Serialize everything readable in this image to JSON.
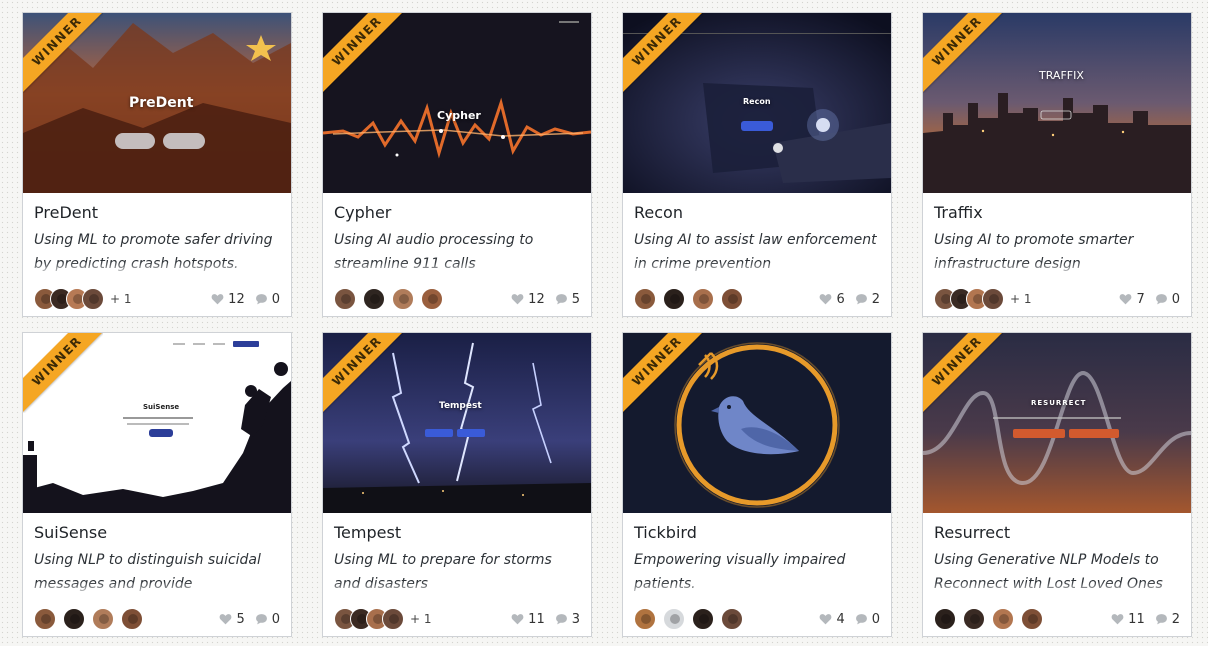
{
  "colors": {
    "ribbon": "#f5a623",
    "card_border": "#cfd2d6",
    "icon_gray": "#b4b8bc"
  },
  "cards": [
    {
      "name": "PreDent",
      "description": "Using ML to promote safer driving by predicting crash hotspots.",
      "badge": "WINNER",
      "thumb_title": "PreDent",
      "likes": "12",
      "comments": "0",
      "extra_members": "+ 1",
      "avatars": [
        "#8a5a3c",
        "#3b2a22",
        "#b77a55",
        "#6b4a3a"
      ]
    },
    {
      "name": "Cypher",
      "description": "Using AI audio processing to streamline 911 calls",
      "badge": "WINNER",
      "thumb_title": "Cypher",
      "likes": "12",
      "comments": "5",
      "extra_members": "",
      "avatars": [
        "#7a5540",
        "#2f2621",
        "#b07c5a",
        "#9a5f3e"
      ]
    },
    {
      "name": "Recon",
      "description": "Using AI to assist law enforcement in crime prevention",
      "badge": "WINNER",
      "thumb_title": "Recon",
      "likes": "6",
      "comments": "2",
      "extra_members": "",
      "avatars": [
        "#8a5a3c",
        "#2b211c",
        "#a86f4c",
        "#7e4f36"
      ]
    },
    {
      "name": "Traffix",
      "description": "Using AI to promote smarter infrastructure design",
      "badge": "WINNER",
      "thumb_title": "TRAFFIX",
      "likes": "7",
      "comments": "0",
      "extra_members": "+ 1",
      "avatars": [
        "#7a5540",
        "#3a2b24",
        "#b27650",
        "#6b4a3a"
      ]
    },
    {
      "name": "SuiSense",
      "description": "Using NLP to distinguish suicidal messages and provide personalized",
      "badge": "WINNER",
      "thumb_title": "SuiSense",
      "likes": "5",
      "comments": "0",
      "extra_members": "",
      "avatars": [
        "#8a5a3c",
        "#2b211c",
        "#b07c5a",
        "#7e4f36"
      ]
    },
    {
      "name": "Tempest",
      "description": "Using ML to prepare for storms and disasters",
      "badge": "WINNER",
      "thumb_title": "Tempest",
      "likes": "11",
      "comments": "3",
      "extra_members": "+ 1",
      "avatars": [
        "#7a5540",
        "#3b2a22",
        "#a86f4c",
        "#6b4a3a"
      ]
    },
    {
      "name": "Tickbird",
      "description": "Empowering visually impaired patients.",
      "badge": "WINNER",
      "thumb_title": "",
      "likes": "4",
      "comments": "0",
      "extra_members": "",
      "avatars": [
        "#b0733f",
        "#d6d9dc",
        "#2b211c",
        "#6b4a3a"
      ]
    },
    {
      "name": "Resurrect",
      "description": "Using Generative NLP Models to Reconnect with Lost Loved Ones",
      "badge": "WINNER",
      "thumb_title": "RESURRECT",
      "likes": "11",
      "comments": "2",
      "extra_members": "",
      "avatars": [
        "#2b211c",
        "#3a2b24",
        "#b27650",
        "#7e4f36"
      ]
    }
  ]
}
